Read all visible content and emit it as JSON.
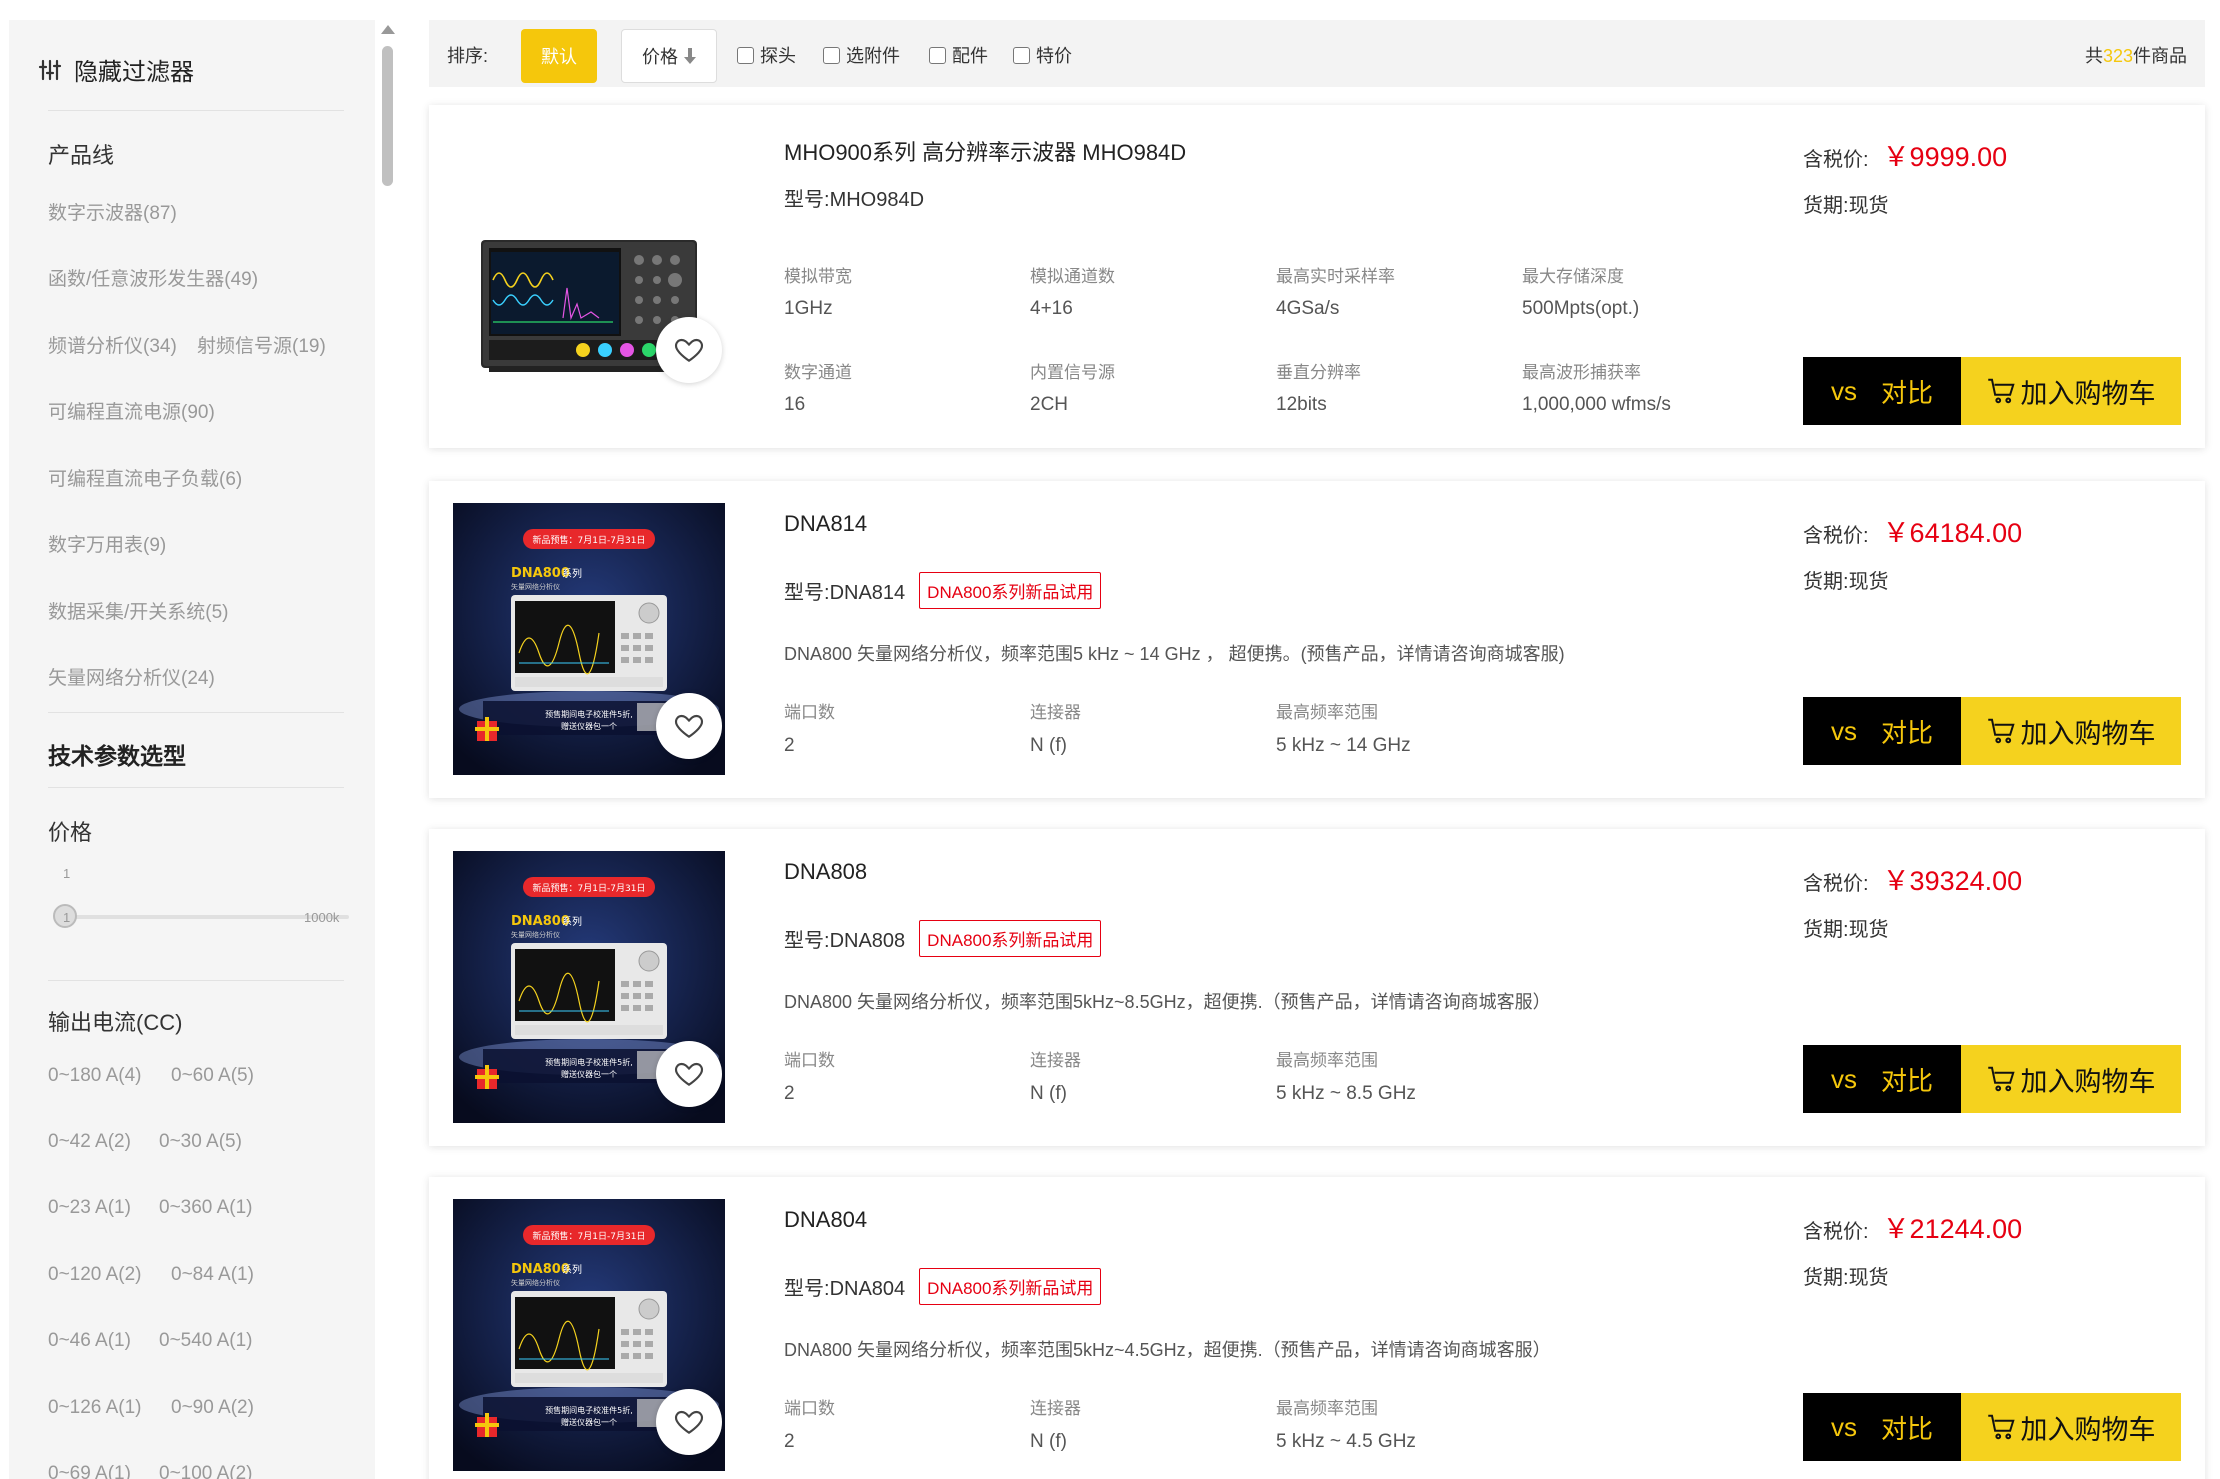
{
  "sidebar": {
    "hide_filter": "隐藏过滤器",
    "product_line_title": "产品线",
    "product_lines": [
      "数字示波器(87)",
      "函数/任意波形发生器(49)",
      "频谱分析仪(34)",
      "射频信号源(19)",
      "可编程直流电源(90)",
      "可编程直流电子负载(6)",
      "数字万用表(9)",
      "数据采集/开关系统(5)",
      "矢量网络分析仪(24)"
    ],
    "tech_title": "技术参数选型",
    "price_title": "价格",
    "price_slider": {
      "value": "1",
      "min_label": "1",
      "max_label": "1000k",
      "fraction": 0
    },
    "current_title": "输出电流(CC)",
    "currents": [
      [
        "0~180 A(4)",
        "0~60 A(5)"
      ],
      [
        "0~42 A(2)",
        "0~30 A(5)"
      ],
      [
        "0~23 A(1)",
        "0~360 A(1)"
      ],
      [
        "0~120 A(2)",
        "0~84 A(1)"
      ],
      [
        "0~46 A(1)",
        "0~540 A(1)"
      ],
      [
        "0~126 A(1)",
        "0~90 A(2)"
      ],
      [
        "0~69 A(1)",
        "0~100 A(2)"
      ]
    ]
  },
  "toolbar": {
    "sort_label": "排序:",
    "default_label": "默认",
    "price_label": "价格",
    "filters": [
      "探头",
      "选附件",
      "配件",
      "特价"
    ],
    "total_prefix": "共",
    "total_count": "323",
    "total_suffix": "件商品"
  },
  "labels": {
    "model_prefix": "型号:",
    "price_prefix": "含税价:",
    "stock_prefix": "货期:",
    "stock_value": "现货",
    "vs": "vs",
    "compare": "对比",
    "add_cart": "加入购物车"
  },
  "products": [
    {
      "name": "MHO900系列 高分辨率示波器 MHO984D",
      "model": "MHO984D",
      "badge": "",
      "desc": "",
      "price": "￥9999.00",
      "specs": [
        {
          "k": "模拟带宽",
          "v": "1GHz"
        },
        {
          "k": "模拟通道数",
          "v": "4+16"
        },
        {
          "k": "最高实时采样率",
          "v": "4GSa/s"
        },
        {
          "k": "最大存储深度",
          "v": "500Mpts(opt.)"
        },
        {
          "k": "数字通道",
          "v": "16"
        },
        {
          "k": "内置信号源",
          "v": "2CH"
        },
        {
          "k": "垂直分辨率",
          "v": "12bits"
        },
        {
          "k": "最高波形捕获率",
          "v": "1,000,000 wfms/s"
        }
      ]
    },
    {
      "name": "DNA814",
      "model": "DNA814",
      "badge": "DNA800系列新品试用",
      "desc": "DNA800 矢量网络分析仪，频率范围5 kHz ~ 14 GHz ， 超便携。(预售产品，详情请咨询商城客服)",
      "price": "￥64184.00",
      "specs": [
        {
          "k": "端口数",
          "v": "2"
        },
        {
          "k": "连接器",
          "v": "N (f)"
        },
        {
          "k": "最高频率范围",
          "v": "5 kHz ~ 14 GHz"
        }
      ]
    },
    {
      "name": "DNA808",
      "model": "DNA808",
      "badge": "DNA800系列新品试用",
      "desc": "DNA800 矢量网络分析仪，频率范围5kHz~8.5GHz，超便携.（预售产品，详情请咨询商城客服）",
      "price": "￥39324.00",
      "specs": [
        {
          "k": "端口数",
          "v": "2"
        },
        {
          "k": "连接器",
          "v": "N (f)"
        },
        {
          "k": "最高频率范围",
          "v": "5 kHz ~ 8.5 GHz"
        }
      ]
    },
    {
      "name": "DNA804",
      "model": "DNA804",
      "badge": "DNA800系列新品试用",
      "desc": "DNA800 矢量网络分析仪，频率范围5kHz~4.5GHz，超便携.（预售产品，详情请咨询商城客服）",
      "price": "￥21244.00",
      "specs": [
        {
          "k": "端口数",
          "v": "2"
        },
        {
          "k": "连接器",
          "v": "N (f)"
        },
        {
          "k": "最高频率范围",
          "v": "5 kHz ~ 4.5 GHz"
        }
      ]
    }
  ],
  "promo_image": {
    "banner": "新品预售：7月1日-7月31日",
    "brand": "DNA800",
    "series": "系列",
    "subtitle": "矢量网络分析仪",
    "footer_1": "预售期间电子校准件5折,",
    "footer_2": "赠送仪器包一个"
  },
  "colors": {
    "accent": "#f5c70c",
    "price": "#e60012",
    "cart": "#f5d21e",
    "vs_bg": "#000000"
  }
}
